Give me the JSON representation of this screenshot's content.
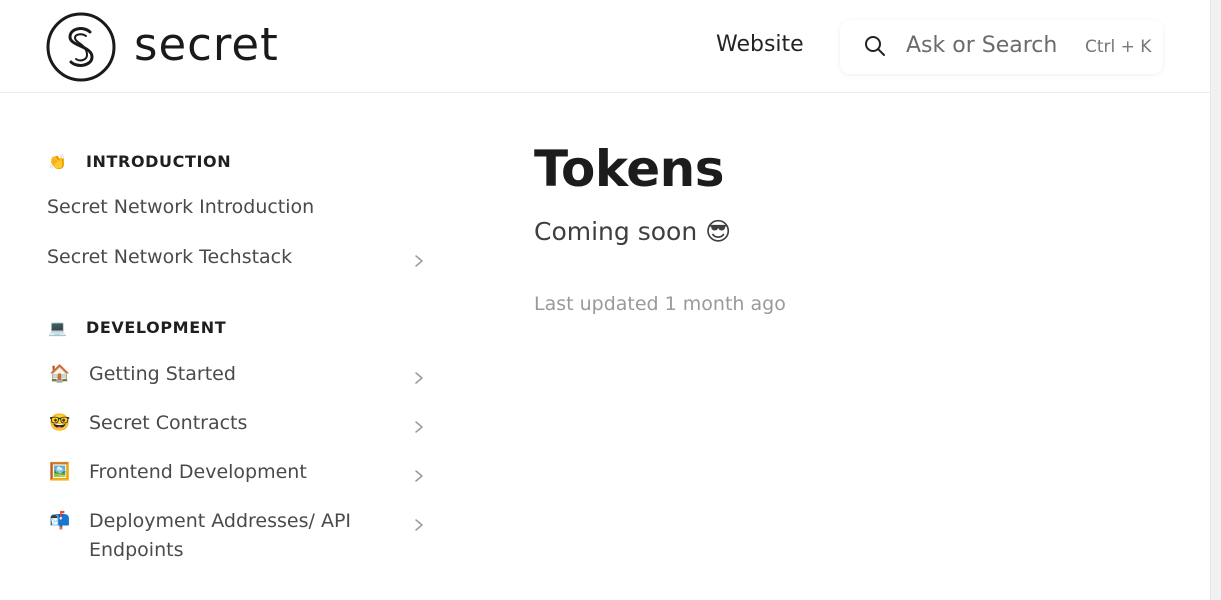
{
  "header": {
    "logo_text": "secret",
    "website_link": "Website",
    "search": {
      "placeholder": "Ask or Search",
      "shortcut": "Ctrl + K"
    }
  },
  "sidebar": {
    "sections": [
      {
        "emoji": "👏",
        "title": "INTRODUCTION",
        "items": [
          {
            "label": "Secret Network Introduction"
          },
          {
            "label": "Secret Network Techstack"
          }
        ]
      },
      {
        "emoji": "💻",
        "title": "DEVELOPMENT",
        "items": [
          {
            "emoji": "🏠",
            "label": "Getting Started"
          },
          {
            "emoji": "🤓",
            "label": "Secret Contracts"
          },
          {
            "emoji": "🖼️",
            "label": "Frontend Development"
          },
          {
            "emoji": "📬",
            "label": "Deployment Addresses/ API Endpoints"
          }
        ]
      }
    ]
  },
  "main": {
    "title": "Tokens",
    "body": "Coming soon 😎",
    "last_updated": "Last updated 1 month ago"
  },
  "colors": {
    "text": "#242424",
    "muted": "#9a9a9a",
    "border": "#ececec"
  }
}
